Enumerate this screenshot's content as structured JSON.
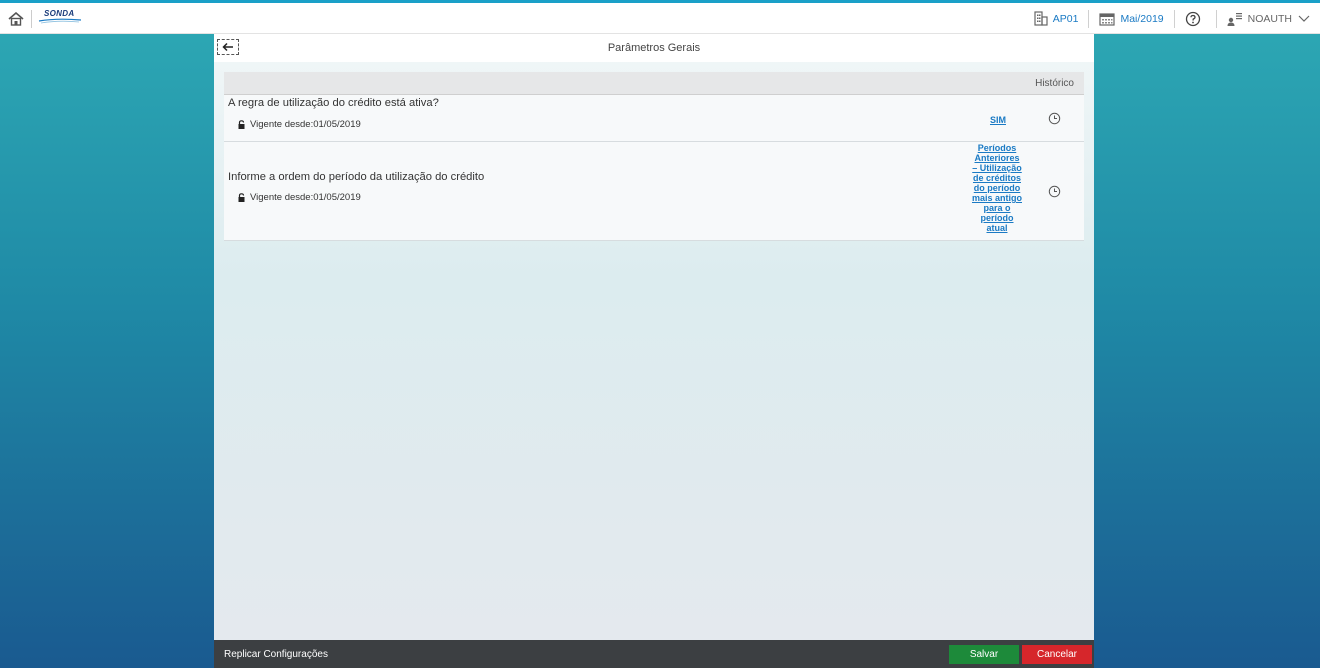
{
  "topbar": {
    "logo_text": "SONDA",
    "company": "AP01",
    "period": "Mai/2019",
    "user": "NOAUTH",
    "icons": [
      "home-icon",
      "building-icon",
      "calendar-icon",
      "help-icon",
      "user-icon",
      "chevron-down-icon"
    ]
  },
  "page": {
    "title": "Parâmetros Gerais",
    "column_header": "Histórico"
  },
  "rows": [
    {
      "question": "A regra de utilização do crédito está ativa?",
      "vigente": "Vigente desde:01/05/2019",
      "value": "SIM"
    },
    {
      "question": "Informe a ordem do período da utilização do crédito",
      "vigente": "Vigente desde:01/05/2019",
      "value_lines": [
        "Períodos",
        "Anteriores",
        "– Utilização",
        "de créditos",
        "do período",
        "mais antigo",
        "para o",
        "período",
        "atual"
      ]
    }
  ],
  "footer": {
    "replicate_label": "Replicar Configurações",
    "save_label": "Salvar",
    "cancel_label": "Cancelar"
  },
  "colors": {
    "accent": "#1a7ac4",
    "save": "#1d8a3a",
    "cancel": "#d6262b",
    "footer_bg": "#3c3f42"
  }
}
